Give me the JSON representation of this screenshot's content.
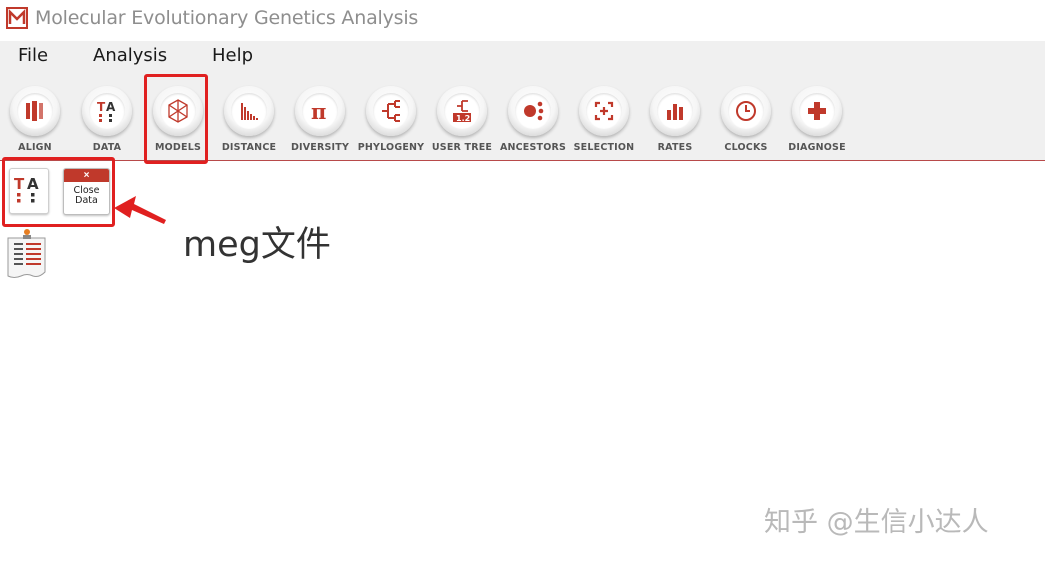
{
  "window": {
    "title": "Molecular Evolutionary Genetics Analysis",
    "logo_icon": "mega-logo-icon"
  },
  "menu": [
    {
      "label": "File"
    },
    {
      "label": "Analysis"
    },
    {
      "label": "Help"
    }
  ],
  "toolbar": [
    {
      "label": "ALIGN",
      "icon": "align-icon"
    },
    {
      "label": "DATA",
      "icon": "ta-data-icon"
    },
    {
      "label": "MODELS",
      "icon": "models-cube-icon"
    },
    {
      "label": "DISTANCE",
      "icon": "distance-bars-icon"
    },
    {
      "label": "DIVERSITY",
      "icon": "pi-icon"
    },
    {
      "label": "PHYLOGENY",
      "icon": "phylogeny-tree-icon"
    },
    {
      "label": "USER TREE",
      "icon": "user-tree-icon"
    },
    {
      "label": "ANCESTORS",
      "icon": "ancestors-icon"
    },
    {
      "label": "SELECTION",
      "icon": "selection-icon"
    },
    {
      "label": "RATES",
      "icon": "rates-chart-icon"
    },
    {
      "label": "CLOCKS",
      "icon": "clock-icon"
    },
    {
      "label": "DIAGNOSE",
      "icon": "plus-icon"
    }
  ],
  "data_panel": {
    "close_icon_text": "×",
    "close_label_line1": "Close",
    "close_label_line2": "Data"
  },
  "annotation": {
    "text": "meg文件"
  },
  "watermark": {
    "text": "知乎 @生信小达人"
  },
  "colors": {
    "accent": "#c0392b",
    "highlight": "#e02020"
  }
}
